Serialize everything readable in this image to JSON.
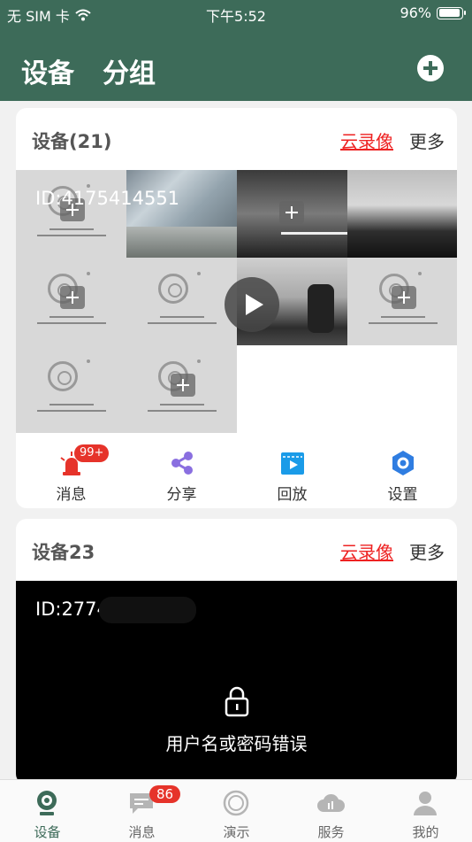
{
  "status_bar": {
    "carrier": "无 SIM 卡",
    "time": "下午5:52",
    "battery": "96%"
  },
  "header": {
    "tabs": [
      "设备",
      "分组"
    ]
  },
  "cards": [
    {
      "title": "设备(21)",
      "cloud_label": "云录像",
      "more_label": "更多",
      "overlay_id": "ID:4175414551",
      "actions": [
        {
          "label": "消息",
          "badge": "99+"
        },
        {
          "label": "分享"
        },
        {
          "label": "回放"
        },
        {
          "label": "设置"
        }
      ]
    },
    {
      "title": "设备23",
      "cloud_label": "云录像",
      "more_label": "更多",
      "device_id": "ID:2774",
      "error_message": "用户名或密码错误"
    }
  ],
  "tabbar": {
    "items": [
      {
        "label": "设备",
        "icon": "camera-icon",
        "active": true
      },
      {
        "label": "消息",
        "icon": "chat-icon",
        "badge": "86"
      },
      {
        "label": "演示",
        "icon": "demo-icon"
      },
      {
        "label": "服务",
        "icon": "cloud-icon"
      },
      {
        "label": "我的",
        "icon": "person-icon"
      }
    ]
  },
  "colors": {
    "primary": "#3d6b59",
    "accent_red": "#e22",
    "badge": "#e6332a"
  }
}
